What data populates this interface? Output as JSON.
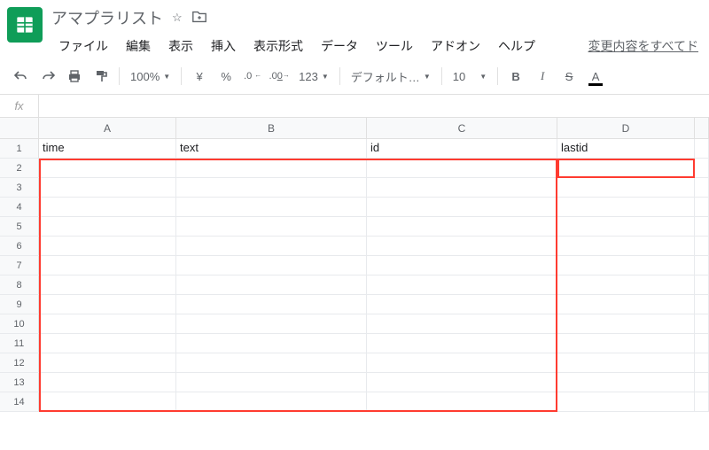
{
  "doc": {
    "title": "アマプラリスト"
  },
  "menus": {
    "file": "ファイル",
    "edit": "編集",
    "view": "表示",
    "insert": "挿入",
    "format": "表示形式",
    "data": "データ",
    "tools": "ツール",
    "addons": "アドオン",
    "help": "ヘルプ",
    "changes": "変更内容をすべてド"
  },
  "toolbar": {
    "zoom": "100%",
    "currency": "¥",
    "percent": "%",
    "dec_dec": ".0",
    "dec_inc": ".00",
    "more_fmt": "123",
    "font": "デフォルト…",
    "font_size": "10",
    "bold": "B",
    "italic": "I",
    "strike": "S",
    "text_color": "A"
  },
  "fx": {
    "label": "fx"
  },
  "columns": [
    "A",
    "B",
    "C",
    "D",
    ""
  ],
  "row_nums": [
    "1",
    "2",
    "3",
    "4",
    "5",
    "6",
    "7",
    "8",
    "9",
    "10",
    "11",
    "12",
    "13",
    "14"
  ],
  "headers": {
    "A": "time",
    "B": "text",
    "C": "id",
    "D": "lastid"
  },
  "chart_data": {
    "type": "table",
    "columns": [
      "time",
      "text",
      "id",
      "lastid"
    ],
    "rows": []
  }
}
